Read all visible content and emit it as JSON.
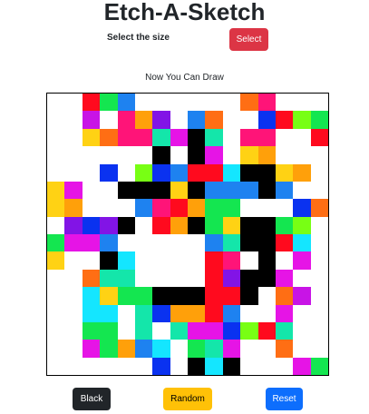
{
  "header": {
    "title": "Etch-A-Sketch"
  },
  "controls": {
    "size_label": "Select the size",
    "select_label": "Select"
  },
  "canvas": {
    "caption": "Now You Can Draw",
    "grid_size": 16,
    "palette": {
      ".": "#ffffff",
      "K": "#000000",
      "R": "#ff0a1e",
      "G": "#14e650",
      "B": "#1e82f0",
      "N": "#0a32f0",
      "M": "#e614e6",
      "P": "#c814e6",
      "O": "#ff6e14",
      "Y": "#ffd214",
      "A": "#ffa00a",
      "C": "#14e6ff",
      "T": "#14e6aa",
      "L": "#78ff14",
      "W": "#ff1478",
      "V": "#8214e6",
      "E": "#00c8ff",
      "S": "#14b4a0"
    },
    "rows": [
      "..RGB......OW...",
      "..P.WAV.BO..NRLG",
      "..YOWWTMKT.WW..R",
      "......K.KM.YA...",
      "...N.LNBRRCKKYA.",
      "YM..KKKYKBBBKB..",
      "YA...BWRAGG...NO",
      ".VNVK.RAKGYKKGL.",
      "GMMB.....BTKKRC.",
      "Y..KC....RW.K.M.",
      "..OTT....RVKKM..",
      "..CYGGKKKRRK.OP.",
      "..CC.TNAARB..M..",
      "..GG.T.TMMNLRT..",
      "..MGABC.GTM..O..",
      "......N.KCK...MG"
    ]
  },
  "buttons": {
    "black_label": "Black",
    "random_label": "Random",
    "reset_label": "Reset"
  }
}
